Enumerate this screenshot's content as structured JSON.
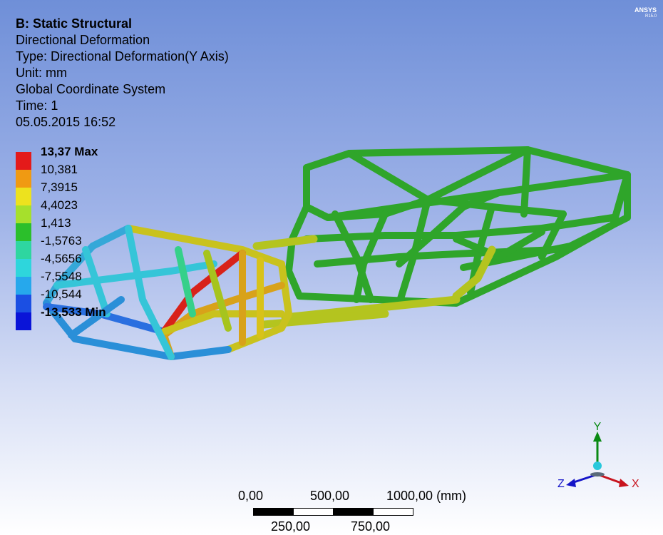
{
  "info": {
    "title": "B: Static Structural",
    "result": "Directional Deformation",
    "type": "Type: Directional Deformation(Y Axis)",
    "unit": "Unit: mm",
    "coord": "Global Coordinate System",
    "time": "Time: 1",
    "date": "05.05.2015 16:52"
  },
  "legend": {
    "entries": [
      {
        "label": "13,37 Max",
        "color": "#e41a1a"
      },
      {
        "label": "10,381",
        "color": "#f09a12"
      },
      {
        "label": "7,3915",
        "color": "#ede21e"
      },
      {
        "label": "4,4023",
        "color": "#a6e02c"
      },
      {
        "label": "1,413",
        "color": "#2bbf2b"
      },
      {
        "label": "-1,5763",
        "color": "#2ed6a0"
      },
      {
        "label": "-4,5656",
        "color": "#2ed6dc"
      },
      {
        "label": "-7,5548",
        "color": "#26a8ec"
      },
      {
        "label": "-10,544",
        "color": "#1b4fe3"
      },
      {
        "label": "-13,533 Min",
        "color": "#0a14d8"
      }
    ]
  },
  "logo": {
    "brand": "ANSYS",
    "version": "R15.0"
  },
  "scale": {
    "top_labels": [
      "0,00",
      "500,00",
      "1000,00 (mm)"
    ],
    "bottom_labels": [
      "250,00",
      "750,00"
    ]
  },
  "axes": {
    "x": "X",
    "y": "Y",
    "z": "Z"
  },
  "colors": {
    "x_axis": "#c8141e",
    "y_axis": "#0a8a14",
    "z_axis": "#1414c8",
    "origin": "#28c8dc",
    "frame_green": "#2fa52a",
    "frame_yellow": "#c9c21d",
    "frame_red": "#d8221a",
    "frame_blue": "#2a6fe0",
    "frame_cyan": "#35c5d8"
  }
}
